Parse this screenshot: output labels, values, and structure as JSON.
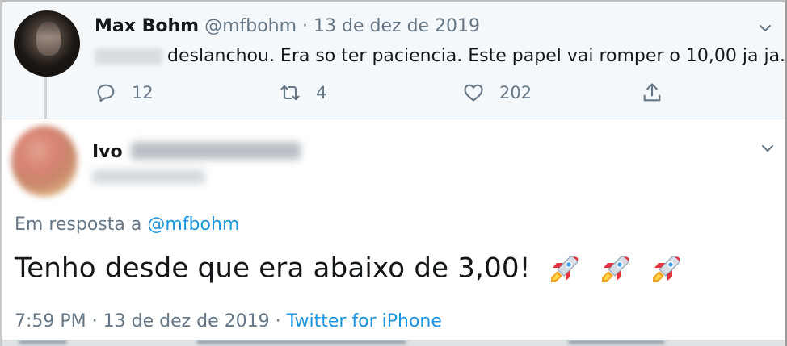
{
  "parent_tweet": {
    "author_name": "Max Bohm",
    "handle": "@mfbohm",
    "separator": "·",
    "date": "13 de dez de 2019",
    "text": "deslanchou. Era so ter paciencia. Este papel vai romper o 10,00 ja ja.",
    "actions": {
      "reply_count": "12",
      "retweet_count": "4",
      "like_count": "202"
    },
    "icons": [
      "reply-icon",
      "retweet-icon",
      "like-icon",
      "share-icon",
      "chevron-down-icon"
    ]
  },
  "reply_tweet": {
    "author_name": "Ivo",
    "reply_label": "Em resposta a",
    "reply_mention": "@mfbohm",
    "text": "Tenho desde que era abaixo de 3,00!",
    "emoji": [
      "rocket",
      "rocket",
      "rocket"
    ],
    "time": "7:59 PM",
    "separator": "·",
    "date": "13 de dez de 2019",
    "separator2": "·",
    "source": "Twitter for iPhone"
  },
  "colors": {
    "text": "#14171a",
    "secondary": "#657786",
    "link": "#1b95e0",
    "parent_bg": "#f5f8fa"
  }
}
